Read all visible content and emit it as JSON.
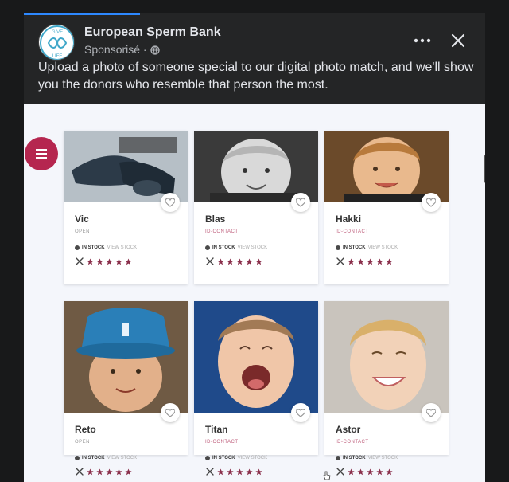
{
  "post": {
    "page_name": "European Sperm Bank",
    "sponsored_label": "Sponsorisé ·",
    "caption": "Upload a photo of someone special to our digital photo match, and we'll show you the donors who resemble that person the most.",
    "avatar_text_top": "GIVE",
    "avatar_text_bottom": "LIFE"
  },
  "media": {
    "donors": [
      {
        "name": "Vic",
        "status": "OPEN",
        "stock_label": "IN STOCK",
        "stock_extra": "VIEW STOCK",
        "stars": 5
      },
      {
        "name": "Blas",
        "status": "ID-CONTACT",
        "stock_label": "IN STOCK",
        "stock_extra": "VIEW STOCK",
        "stars": 5
      },
      {
        "name": "Hakki",
        "status": "ID-CONTACT",
        "stock_label": "IN STOCK",
        "stock_extra": "VIEW STOCK",
        "stars": 5
      },
      {
        "name": "Reto",
        "status": "OPEN",
        "stock_label": "IN STOCK",
        "stock_extra": "VIEW STOCK",
        "stars": 5
      },
      {
        "name": "Titan",
        "status": "ID-CONTACT",
        "stock_label": "IN STOCK",
        "stock_extra": "VIEW STOCK",
        "stars": 5
      },
      {
        "name": "Astor",
        "status": "ID-CONTACT",
        "stock_label": "IN STOCK",
        "stock_extra": "VIEW STOCK",
        "stars": 5
      }
    ]
  },
  "colors": {
    "brand": "#b5264f",
    "open_status": "#999999",
    "contact_status": "#c0627f",
    "star": "#8a2f4b"
  }
}
